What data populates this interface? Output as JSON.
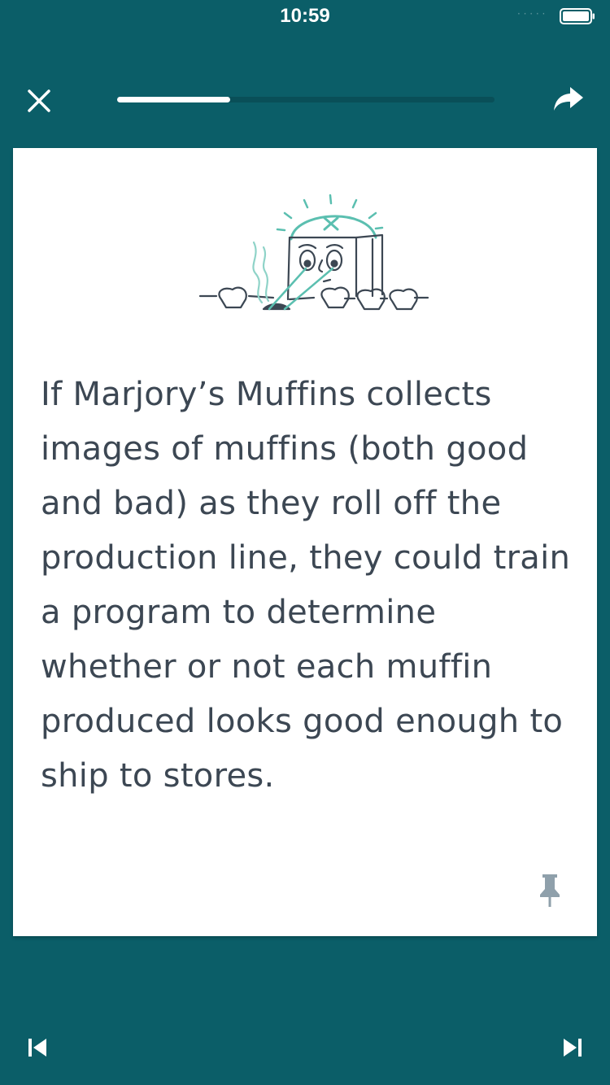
{
  "status_bar": {
    "time": "10:59",
    "signal_dots": "· · · · ·",
    "battery_icon": "battery-full-icon"
  },
  "header": {
    "close_icon": "close-icon",
    "share_icon": "share-arrow-icon",
    "progress": 0.3
  },
  "card": {
    "illustration": "muffin-inspection-robot-illustration",
    "text": "If Marjory’s Muffins collects images of muffins (both good and bad) as they roll off the production line, they could train a program to determine whether or not each muffin produced looks good enough to ship to stores.",
    "pin_icon": "pin-icon"
  },
  "footer": {
    "previous_icon": "skip-previous-icon",
    "next_icon": "skip-next-icon"
  },
  "colors": {
    "background": "#0b5e68",
    "card": "#ffffff",
    "text": "#3c4753",
    "accent": "#5bbfb0",
    "pin": "#8fa0ab"
  }
}
